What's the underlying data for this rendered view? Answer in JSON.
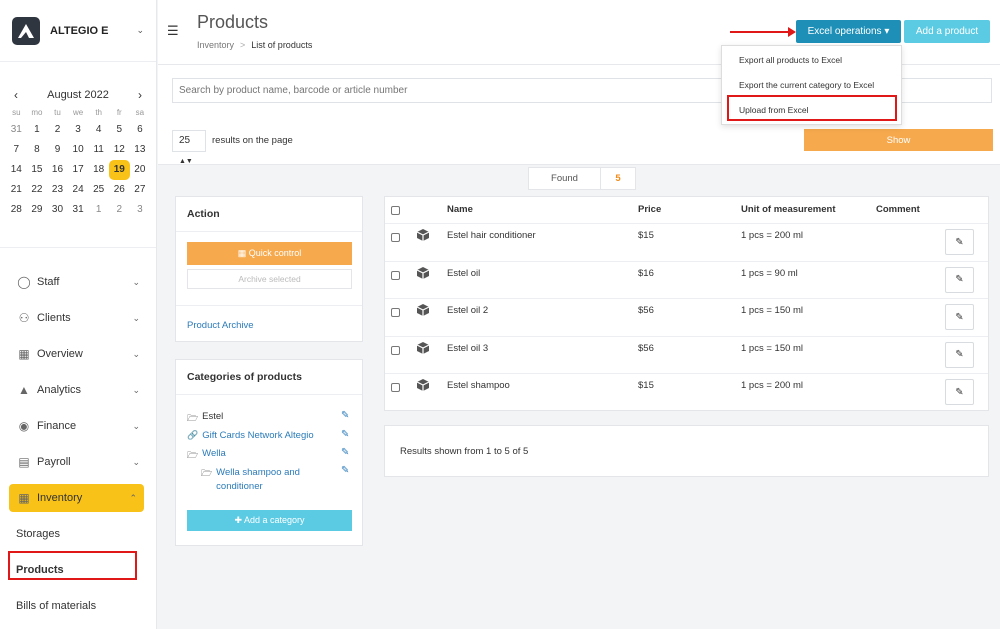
{
  "brand": {
    "name": "ALTEGIO E"
  },
  "calendar": {
    "month": "August 2022",
    "weekdays": [
      "su",
      "mo",
      "tu",
      "we",
      "th",
      "fr",
      "sa"
    ],
    "days": [
      {
        "n": "31",
        "other": true
      },
      {
        "n": "1"
      },
      {
        "n": "2"
      },
      {
        "n": "3"
      },
      {
        "n": "4"
      },
      {
        "n": "5"
      },
      {
        "n": "6"
      },
      {
        "n": "7"
      },
      {
        "n": "8"
      },
      {
        "n": "9"
      },
      {
        "n": "10"
      },
      {
        "n": "11"
      },
      {
        "n": "12"
      },
      {
        "n": "13"
      },
      {
        "n": "14"
      },
      {
        "n": "15"
      },
      {
        "n": "16"
      },
      {
        "n": "17"
      },
      {
        "n": "18"
      },
      {
        "n": "19",
        "today": true
      },
      {
        "n": "20"
      },
      {
        "n": "21"
      },
      {
        "n": "22"
      },
      {
        "n": "23"
      },
      {
        "n": "24"
      },
      {
        "n": "25"
      },
      {
        "n": "26"
      },
      {
        "n": "27"
      },
      {
        "n": "28"
      },
      {
        "n": "29"
      },
      {
        "n": "30"
      },
      {
        "n": "31"
      },
      {
        "n": "1",
        "other": true
      },
      {
        "n": "2",
        "other": true
      },
      {
        "n": "3",
        "other": true
      }
    ]
  },
  "sidebar": {
    "items": [
      {
        "label": "Staff",
        "icon": "person-icon"
      },
      {
        "label": "Clients",
        "icon": "clients-icon"
      },
      {
        "label": "Overview",
        "icon": "grid-icon"
      },
      {
        "label": "Analytics",
        "icon": "analytics-icon"
      },
      {
        "label": "Finance",
        "icon": "coin-icon"
      },
      {
        "label": "Payroll",
        "icon": "payroll-icon"
      }
    ],
    "active": {
      "label": "Inventory",
      "icon": "inventory-icon"
    },
    "sub": [
      "Storages",
      "Products",
      "Bills of materials"
    ]
  },
  "header": {
    "title": "Products",
    "breadcrumb": [
      "Inventory",
      "List of products"
    ],
    "excel_label": "Excel operations",
    "add_label": "Add a product"
  },
  "dropdown": {
    "items": [
      "Export all products to Excel",
      "Export the current category to Excel",
      "Upload from Excel"
    ]
  },
  "filter": {
    "search_placeholder": "Search by product name, barcode or article number",
    "per_page": "25",
    "per_page_label": "results on the page",
    "show_label": "Show"
  },
  "found": {
    "label": "Found",
    "count": "5"
  },
  "action_panel": {
    "title": "Action",
    "quick_label": "Quick control",
    "archive_label": "Archive selected",
    "archive_link": "Product Archive"
  },
  "categories": {
    "title": "Categories of products",
    "items": [
      "Estel",
      "Gift Cards Network Altegio",
      "Wella",
      "Wella shampoo and conditioner"
    ],
    "add_label": "Add a category"
  },
  "table": {
    "headers": [
      "Name",
      "Price",
      "Unit of measurement",
      "Comment"
    ],
    "rows": [
      {
        "name": "Estel hair conditioner",
        "price": "$15",
        "unit": "1 pcs = 200 ml"
      },
      {
        "name": "Estel oil",
        "price": "$16",
        "unit": "1 pcs = 90 ml"
      },
      {
        "name": "Estel oil 2",
        "price": "$56",
        "unit": "1 pcs = 150 ml"
      },
      {
        "name": "Estel oil 3",
        "price": "$56",
        "unit": "1 pcs = 150 ml"
      },
      {
        "name": "Estel shampoo",
        "price": "$15",
        "unit": "1 pcs = 200 ml"
      }
    ]
  },
  "results_text": "Results shown from 1 to 5 of 5",
  "colors": {
    "accent": "#f8c219",
    "primary": "#1e90b8",
    "info": "#5bcbe4",
    "warning": "#f6a94d",
    "highlight": "#e01818"
  }
}
